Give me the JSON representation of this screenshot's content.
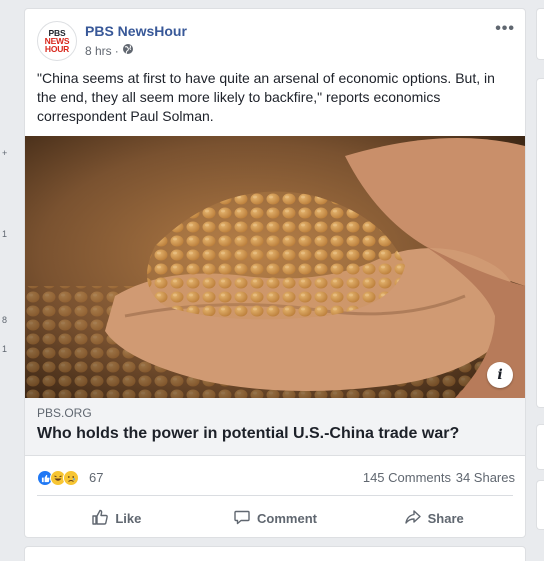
{
  "left_gutter": {
    "markers": [
      "+",
      "1",
      "8",
      "1"
    ]
  },
  "post": {
    "page_name": "PBS NewsHour",
    "avatar_logo": [
      "PBS",
      "NEWS",
      "HOUR"
    ],
    "timestamp": "8 hrs",
    "separator": "·",
    "privacy_icon": "globe-icon",
    "more_label": "•••",
    "text": "\"China seems at first to have quite an arsenal of economic options. But, in the end, they all seem more likely to backfire,\" reports economics correspondent Paul Solman.",
    "info_label": "i",
    "link": {
      "domain": "PBS.ORG",
      "title": "Who holds the power in potential U.S.-China trade war?"
    },
    "reactions": {
      "icons": [
        "like-icon",
        "haha-icon",
        "sad-icon"
      ],
      "count": "67",
      "comments": "145 Comments",
      "shares": "34 Shares"
    },
    "actions": {
      "like": "Like",
      "comment": "Comment",
      "share": "Share"
    }
  },
  "colors": {
    "page_name": "#385898",
    "like_blue": "#2078f4",
    "reaction_yellow": "#f7c533",
    "background": "#e9ebee"
  }
}
